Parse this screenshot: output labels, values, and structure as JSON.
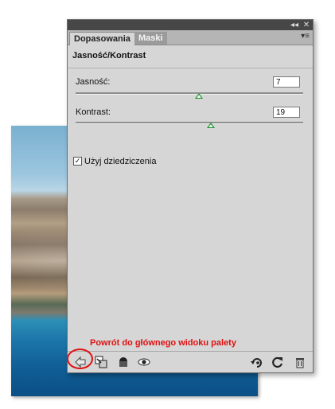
{
  "panel": {
    "tabs": [
      {
        "label": "Dopasowania",
        "active": true
      },
      {
        "label": "Maski",
        "active": false
      }
    ],
    "title": "Jasność/Kontrast",
    "brightness": {
      "label": "Jasność:",
      "value": "7"
    },
    "contrast": {
      "label": "Kontrast:",
      "value": "19"
    },
    "legacy_checkbox": {
      "label": "Użyj dziedziczenia",
      "checked": true
    }
  },
  "annotation": {
    "text": "Powrót do głównego widoku palety"
  },
  "icons": {
    "collapse": "double-chevron-icon",
    "close": "close-icon",
    "panel_menu": "panel-menu-icon",
    "back": "back-arrow-icon",
    "clip": "clip-to-layer-icon",
    "mask": "layer-mask-icon",
    "visibility": "eye-icon",
    "view_previous": "view-previous-icon",
    "reset": "reset-icon",
    "delete": "trash-icon"
  },
  "colors": {
    "accent": "#e01010",
    "slider_thumb": "#1a8f2a"
  }
}
